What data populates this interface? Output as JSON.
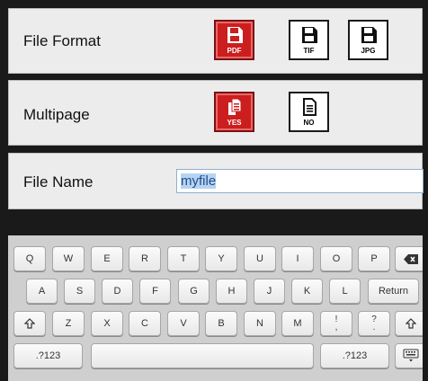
{
  "file_format": {
    "label": "File Format",
    "options": [
      {
        "caption": "PDF",
        "selected": true,
        "icon": "floppy-disk-icon"
      },
      {
        "caption": "TIF",
        "selected": false,
        "icon": "floppy-disk-icon"
      },
      {
        "caption": "JPG",
        "selected": false,
        "icon": "floppy-disk-icon"
      }
    ]
  },
  "multipage": {
    "label": "Multipage",
    "options": [
      {
        "caption": "YES",
        "selected": true,
        "icon": "multi-document-icon"
      },
      {
        "caption": "NO",
        "selected": false,
        "icon": "single-document-icon"
      }
    ]
  },
  "file_name": {
    "label": "File Name",
    "value": "myfile"
  },
  "keyboard": {
    "row1": [
      "Q",
      "W",
      "E",
      "R",
      "T",
      "Y",
      "U",
      "I",
      "O",
      "P"
    ],
    "backspace_icon": "backspace-icon",
    "row2": [
      "A",
      "S",
      "D",
      "F",
      "G",
      "H",
      "J",
      "K",
      "L"
    ],
    "return_label": "Return",
    "shift_icon": "shift-icon",
    "row3": [
      "Z",
      "X",
      "C",
      "V",
      "B",
      "N",
      "M"
    ],
    "punct1": {
      "top": "!",
      "bottom": ","
    },
    "punct2": {
      "top": "?",
      "bottom": "."
    },
    "numbers_label_left": ".?123",
    "numbers_label_right": ".?123",
    "hide_keyboard_icon": "keyboard-hide-icon"
  },
  "colors": {
    "selected_red": "#cc1e1e",
    "panel_bg": "#ececec",
    "background": "#1a1a1a"
  }
}
